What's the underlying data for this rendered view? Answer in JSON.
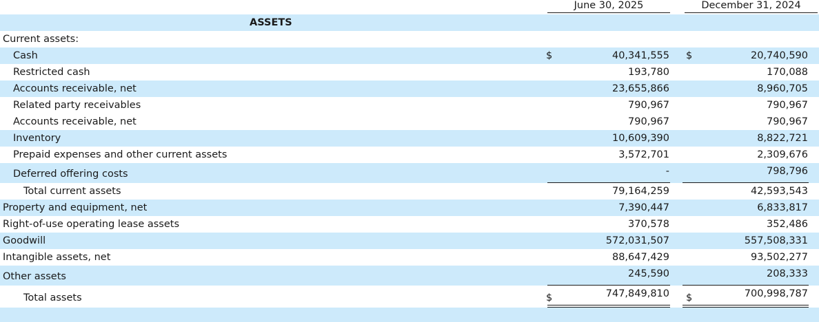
{
  "columns": {
    "col1": "June 30, 2025",
    "col2": "December 31, 2024"
  },
  "section_title": "ASSETS",
  "currency_symbol": "$",
  "current_assets_heading": "Current assets:",
  "current_items": [
    {
      "label": "Cash",
      "col1": "40,341,555",
      "col2": "20,740,590",
      "currency": true
    },
    {
      "label": "Restricted cash",
      "col1": "193,780",
      "col2": "170,088"
    },
    {
      "label": "Accounts receivable, net",
      "col1": "23,655,866",
      "col2": "8,960,705"
    },
    {
      "label": "Related party receivables",
      "col1": "790,967",
      "col2": "790,967"
    },
    {
      "label": "Accounts receivable, net",
      "col1": "790,967",
      "col2": "790,967"
    },
    {
      "label": "Inventory",
      "col1": "10,609,390",
      "col2": "8,822,721"
    },
    {
      "label": "Prepaid expenses and other current assets",
      "col1": "3,572,701",
      "col2": "2,309,676"
    },
    {
      "label": "Deferred offering costs",
      "col1": "-",
      "col2": "798,796"
    }
  ],
  "total_current": {
    "label": "Total current assets",
    "col1": "79,164,259",
    "col2": "42,593,543"
  },
  "noncurrent_items": [
    {
      "label": "Property and equipment, net",
      "col1": "7,390,447",
      "col2": "6,833,817"
    },
    {
      "label": "Right-of-use operating lease assets",
      "col1": "370,578",
      "col2": "352,486"
    },
    {
      "label": "Goodwill",
      "col1": "572,031,507",
      "col2": "557,508,331"
    },
    {
      "label": "Intangible assets, net",
      "col1": "88,647,429",
      "col2": "93,502,277"
    },
    {
      "label": "Other assets",
      "col1": "245,590",
      "col2": "208,333"
    }
  ],
  "total_assets": {
    "label": "Total assets",
    "col1": "747,849,810",
    "col2": "700,998,787"
  }
}
